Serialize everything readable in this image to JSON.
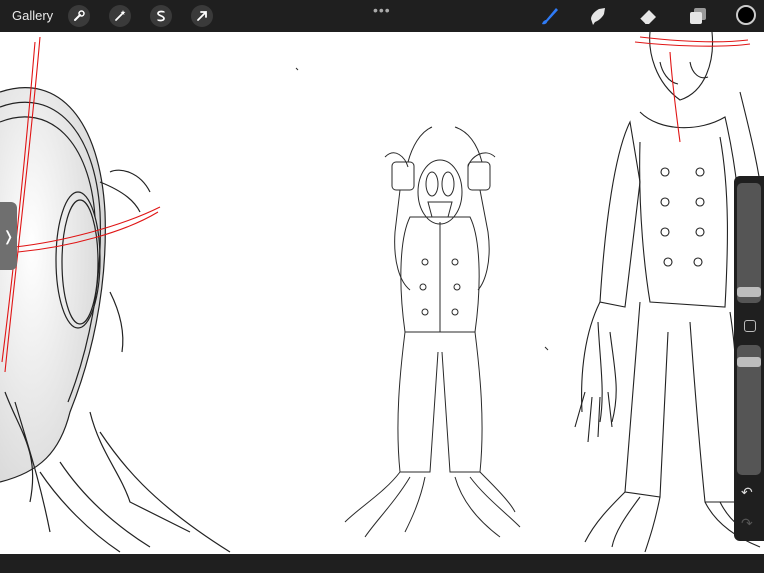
{
  "toolbar": {
    "gallery_label": "Gallery",
    "left_tools": [
      "wrench-icon",
      "magic-wand-icon",
      "selection-s-icon",
      "transform-arrow-icon"
    ],
    "more_label": "•••",
    "right_tools": [
      "brush-icon",
      "smudge-icon",
      "eraser-icon",
      "layers-icon"
    ],
    "active_tool": "brush-icon",
    "current_color": "#000000",
    "accent_color": "#2f7bf6"
  },
  "sidebar": {
    "expand_glyph": "❭",
    "undo_glyph": "↶",
    "redo_glyph": "↷"
  }
}
